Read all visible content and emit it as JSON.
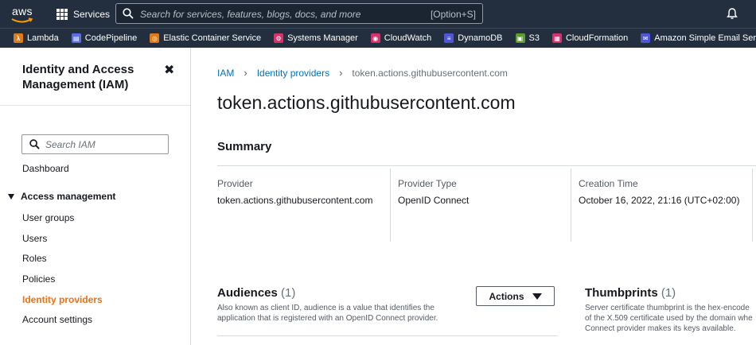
{
  "topnav": {
    "logo_text": "aws",
    "services_label": "Services",
    "search_placeholder": "Search for services, features, blogs, docs, and more",
    "search_shortcut": "[Option+S]"
  },
  "favorites": [
    {
      "label": "Lambda",
      "color": "#e07b1a",
      "glyph": "λ"
    },
    {
      "label": "CodePipeline",
      "color": "#5a6ee8",
      "glyph": "▤"
    },
    {
      "label": "Elastic Container Service",
      "color": "#e07b1a",
      "glyph": "◎"
    },
    {
      "label": "Systems Manager",
      "color": "#d6336c",
      "glyph": "⚙"
    },
    {
      "label": "CloudWatch",
      "color": "#d6336c",
      "glyph": "◉"
    },
    {
      "label": "DynamoDB",
      "color": "#4f56d8",
      "glyph": "≡"
    },
    {
      "label": "S3",
      "color": "#5d9c2e",
      "glyph": "▣"
    },
    {
      "label": "CloudFormation",
      "color": "#d6336c",
      "glyph": "▦"
    },
    {
      "label": "Amazon Simple Email Service",
      "color": "#4f56d8",
      "glyph": "✉"
    }
  ],
  "sidebar": {
    "title": "Identity and Access Management (IAM)",
    "search_placeholder": "Search IAM",
    "dashboard": "Dashboard",
    "section": "Access management",
    "items": [
      "User groups",
      "Users",
      "Roles",
      "Policies",
      "Identity providers",
      "Account settings"
    ],
    "active_item": "Identity providers"
  },
  "breadcrumb": {
    "root": "IAM",
    "parent": "Identity providers",
    "current": "token.actions.githubusercontent.com"
  },
  "page": {
    "title": "token.actions.githubusercontent.com"
  },
  "summary": {
    "heading": "Summary",
    "fields": [
      {
        "label": "Provider",
        "value": "token.actions.githubusercontent.com"
      },
      {
        "label": "Provider Type",
        "value": "OpenID Connect"
      },
      {
        "label": "Creation Time",
        "value": "October 16, 2022, 21:16 (UTC+02:00)"
      }
    ]
  },
  "audiences": {
    "heading": "Audiences",
    "count": "(1)",
    "description": "Also known as client ID, audience is a value that identifies the application that is registered with an OpenID Connect provider.",
    "actions_label": "Actions"
  },
  "thumbprints": {
    "heading": "Thumbprints",
    "count": "(1)",
    "description_lines": [
      "Server certificate thumbprint is the hex-encode",
      "of the X.509 certificate used by the domain whe",
      "Connect provider makes its keys available."
    ]
  }
}
